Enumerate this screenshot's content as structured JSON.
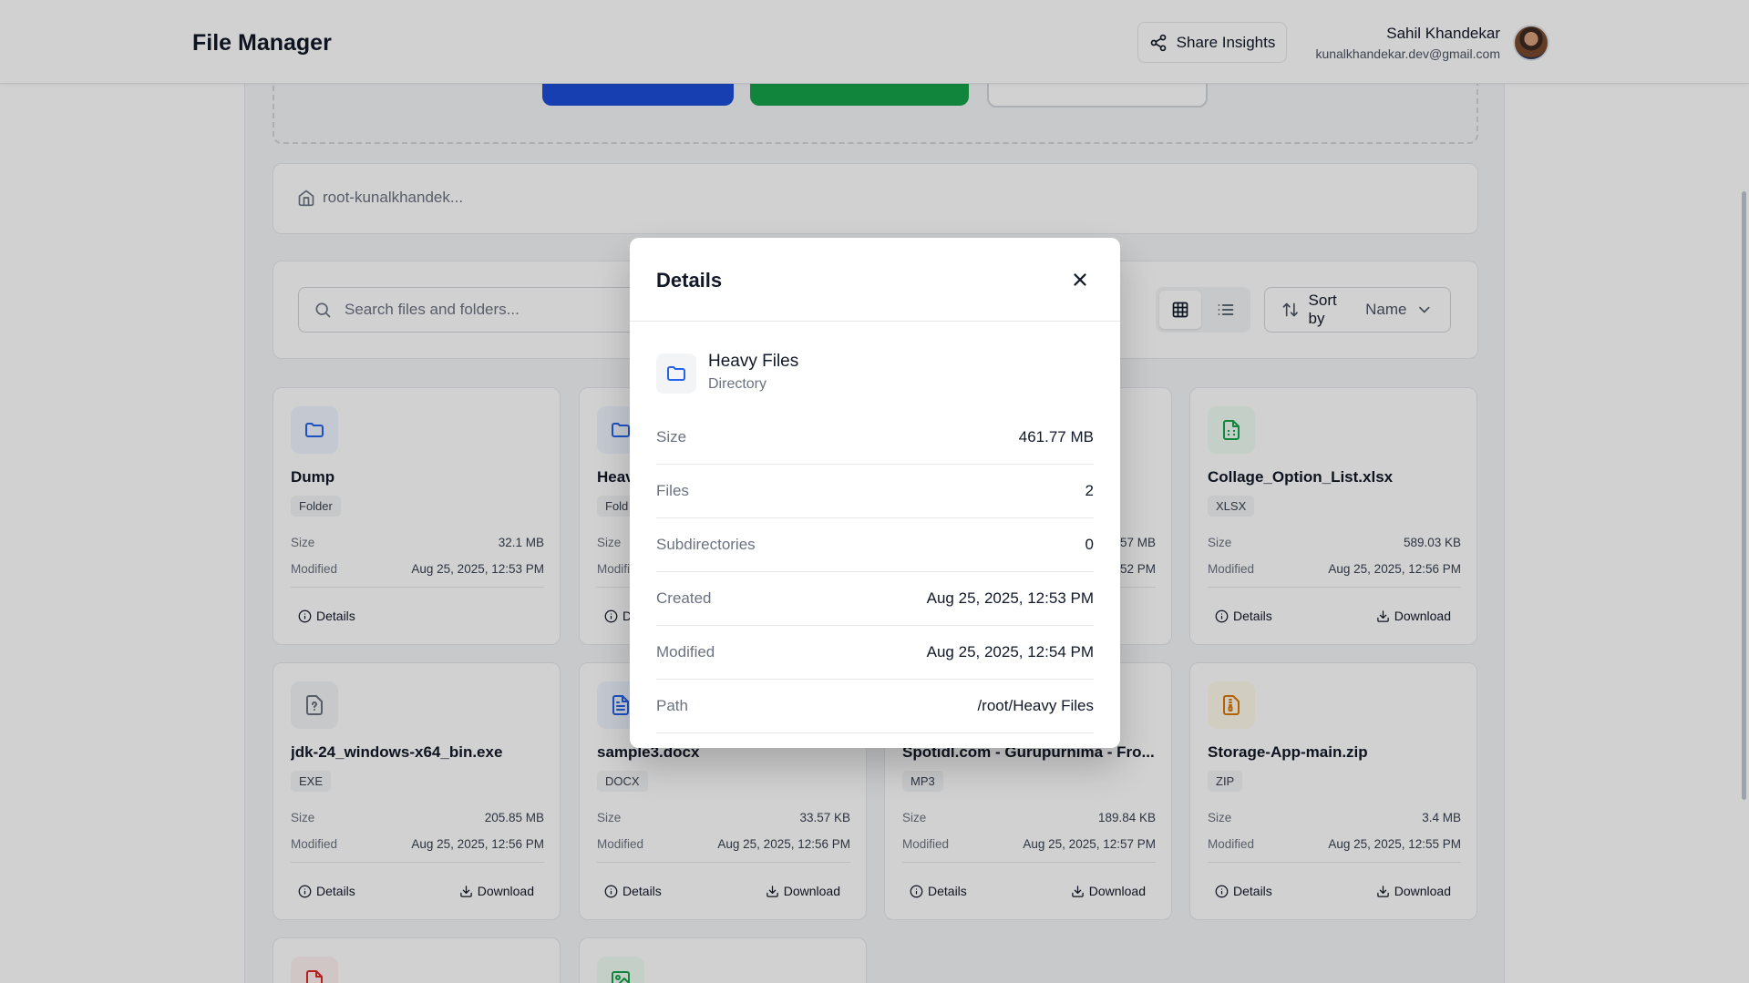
{
  "header": {
    "title": "File Manager",
    "share_label": "Share Insights",
    "user_name": "Sahil Khandekar",
    "user_email": "kunalkhandekar.dev@gmail.com"
  },
  "breadcrumb": {
    "path": "root-kunalkhandek..."
  },
  "toolbar": {
    "search_placeholder": "Search files and folders...",
    "sort_label": "Sort by",
    "sort_value": "Name",
    "view_mode": "grid"
  },
  "labels": {
    "size": "Size",
    "modified": "Modified",
    "details": "Details",
    "download": "Download"
  },
  "cards": [
    {
      "name": "Dump",
      "badge": "Folder",
      "size": "32.1 MB",
      "modified": "Aug 25, 2025, 12:53 PM",
      "icon": "folder-icon",
      "color": "#2563eb"
    },
    {
      "name": "Heav",
      "badge": "Fold",
      "size": "",
      "modified": "",
      "icon": "folder-icon",
      "color": "#2563eb"
    },
    {
      "name": "",
      "badge": "",
      "size": "57 MB",
      "modified": "52 PM",
      "icon": "",
      "color": ""
    },
    {
      "name": "Collage_Option_List.xlsx",
      "badge": "XLSX",
      "size": "589.03 KB",
      "modified": "Aug 25, 2025, 12:56 PM",
      "icon": "spreadsheet-icon",
      "color": "#16a34a"
    },
    {
      "name": "jdk-24_windows-x64_bin.exe",
      "badge": "EXE",
      "size": "205.85 MB",
      "modified": "Aug 25, 2025, 12:56 PM",
      "icon": "unknown-file-icon",
      "color": "#6b7280"
    },
    {
      "name": "sample3.docx",
      "badge": "DOCX",
      "size": "33.57 KB",
      "modified": "Aug 25, 2025, 12:56 PM",
      "icon": "document-icon",
      "color": "#2563eb"
    },
    {
      "name": "Spotidl.com - Gurupurnima - Fro...",
      "badge": "MP3",
      "size": "189.84 KB",
      "modified": "Aug 25, 2025, 12:57 PM",
      "icon": "audio-icon",
      "color": "#7c3aed"
    },
    {
      "name": "Storage-App-main.zip",
      "badge": "ZIP",
      "size": "3.4 MB",
      "modified": "Aug 25, 2025, 12:55 PM",
      "icon": "archive-icon",
      "color": "#d97706"
    }
  ],
  "modal": {
    "title": "Details",
    "item_name": "Heavy Files",
    "item_type": "Directory",
    "rows": [
      {
        "label": "Size",
        "value": "461.77 MB"
      },
      {
        "label": "Files",
        "value": "2"
      },
      {
        "label": "Subdirectories",
        "value": "0"
      },
      {
        "label": "Created",
        "value": "Aug 25, 2025, 12:53 PM"
      },
      {
        "label": "Modified",
        "value": "Aug 25, 2025, 12:54 PM"
      },
      {
        "label": "Path",
        "value": "/root/Heavy Files"
      }
    ]
  }
}
